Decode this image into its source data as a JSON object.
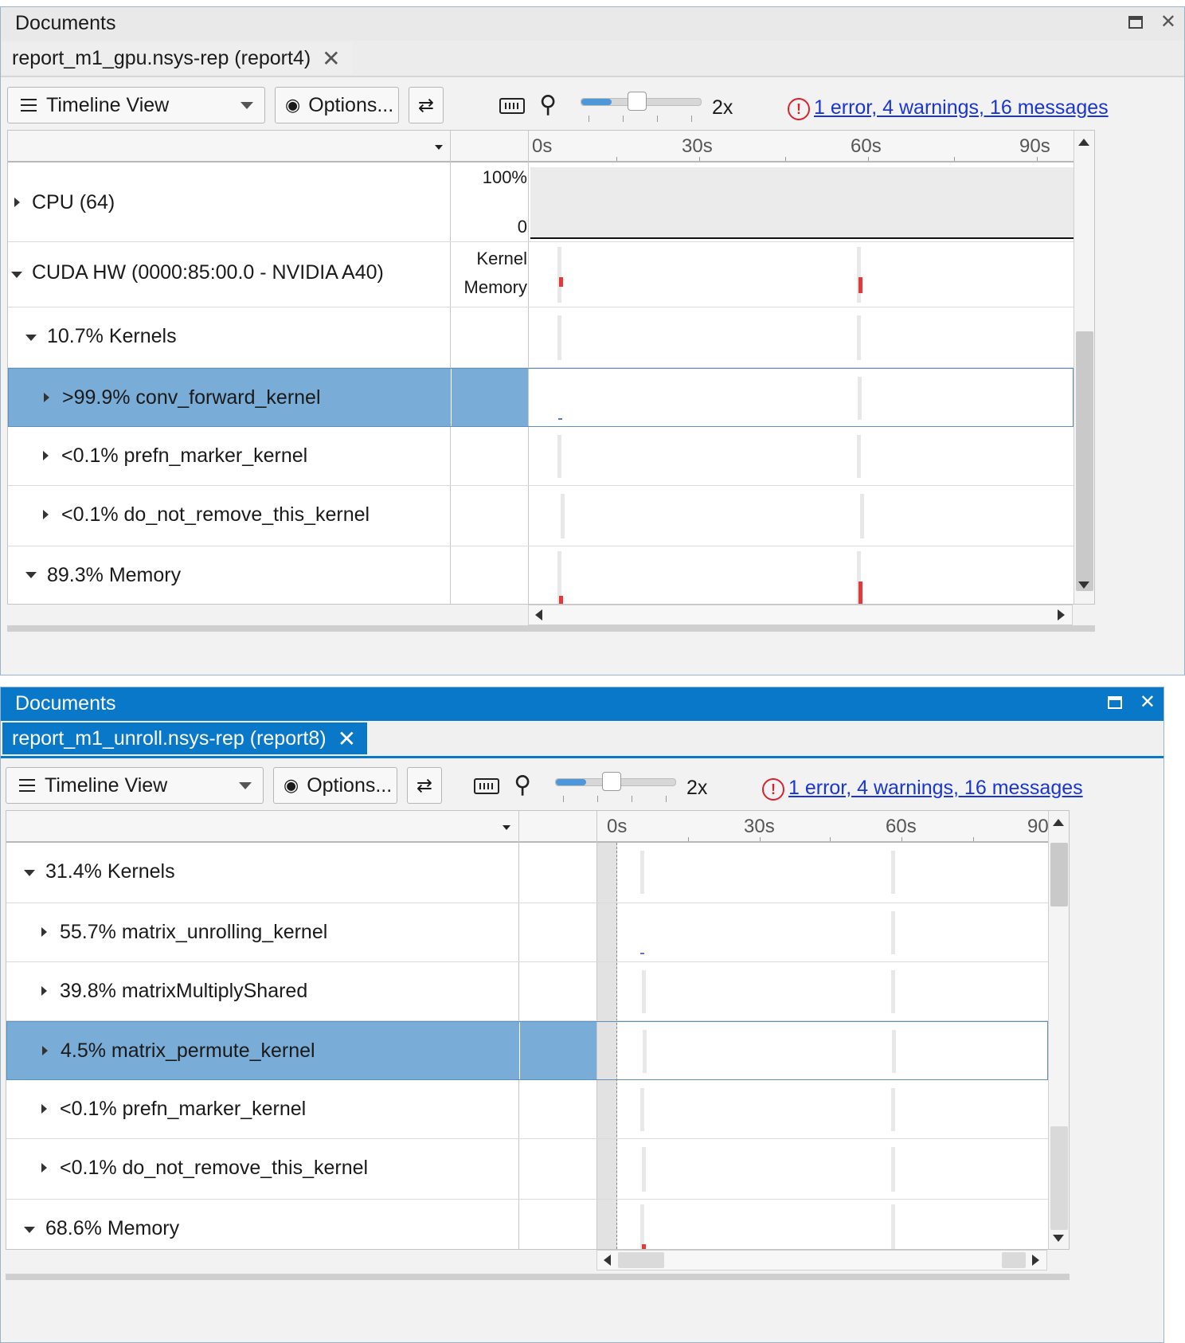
{
  "colors": {
    "accent": "#0a78c9",
    "selection": "#79acd6",
    "error": "#d9232d",
    "link": "#1a35d6",
    "memory_mark": "#e03a3a",
    "kernel_mark": "#5a78c8"
  },
  "icons": {
    "view_menu": "hamburger-icon",
    "options": "eye-icon",
    "swap": "swap-arrows-icon",
    "keyboard": "keyboard-icon",
    "zoom": "zoom-out-icon",
    "error": "error-circle-icon"
  },
  "panel1": {
    "title": "Documents",
    "tab_label": "report_m1_gpu.nsys-rep (report4)",
    "toolbar": {
      "view_label": "Timeline View",
      "options_label": "Options...",
      "zoom_label": "2x",
      "zoom_fraction": 0.25,
      "messages_link": "1 error, 4 warnings, 16 messages"
    },
    "ruler": [
      "0s",
      "30s",
      "60s",
      "90s"
    ],
    "rows": [
      {
        "label": "CPU (64)",
        "axis_top": "100%",
        "axis_bottom": "0"
      },
      {
        "label": "CUDA HW (0000:85:00.0 - NVIDIA A40)",
        "mid_top": "Kernel",
        "mid_bottom": "Memory"
      },
      {
        "label": "10.7% Kernels"
      },
      {
        "label": ">99.9% conv_forward_kernel"
      },
      {
        "label": "<0.1% prefn_marker_kernel"
      },
      {
        "label": "<0.1% do_not_remove_this_kernel"
      },
      {
        "label": "89.3% Memory"
      }
    ]
  },
  "panel2": {
    "title": "Documents",
    "tab_label": "report_m1_unroll.nsys-rep (report8)",
    "toolbar": {
      "view_label": "Timeline View",
      "options_label": "Options...",
      "zoom_label": "2x",
      "zoom_fraction": 0.25,
      "messages_link": "1 error, 4 warnings, 16 messages"
    },
    "ruler": [
      "0s",
      "30s",
      "60s",
      "90"
    ],
    "rows": [
      {
        "label": "31.4% Kernels"
      },
      {
        "label": "55.7% matrix_unrolling_kernel"
      },
      {
        "label": "39.8% matrixMultiplyShared"
      },
      {
        "label": "4.5% matrix_permute_kernel"
      },
      {
        "label": "<0.1% prefn_marker_kernel"
      },
      {
        "label": "<0.1% do_not_remove_this_kernel"
      },
      {
        "label": "68.6% Memory"
      }
    ]
  }
}
